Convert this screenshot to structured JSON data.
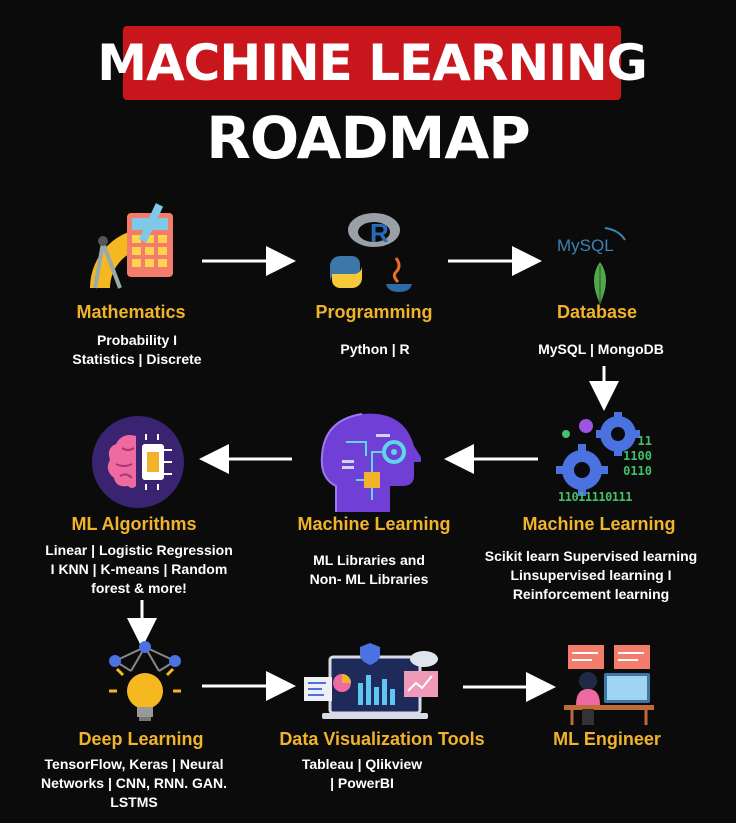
{
  "header": {
    "title": "MACHINE LEARNING",
    "subtitle": "ROADMAP"
  },
  "nodes": [
    {
      "title": "Mathematics",
      "desc": "Probability I\nStatistics | Discrete",
      "icon": "math-tools-icon"
    },
    {
      "title": "Programming",
      "desc": "Python | R",
      "icon": "programming-languages-icon"
    },
    {
      "title": "Database",
      "desc": "MySQL | MongoDB",
      "icon": "database-icon"
    },
    {
      "title": "ML Algorithms",
      "desc": "Linear | Logistic Regression\nI KNN | K-means | Random\nforest & more!",
      "icon": "brain-chip-icon"
    },
    {
      "title": "Machine Learning",
      "desc": "ML Libraries and\nNon- ML Libraries",
      "icon": "ai-head-icon"
    },
    {
      "title": "Machine Learning",
      "desc": "Scikit learn Supervised learning\nLinsupervised learning I\nReinforcement learning",
      "icon": "gears-binary-icon"
    },
    {
      "title": "Deep Learning",
      "desc": "TensorFlow, Keras | Neural\nNetworks | CNN, RNN. GAN.\nLSTMS",
      "icon": "neural-bulb-icon"
    },
    {
      "title": "Data Visualization Tools",
      "desc": "Tableau | Qlikview\n| PowerBI",
      "icon": "dashboard-icon"
    },
    {
      "title": "ML Engineer",
      "desc": "",
      "icon": "engineer-desk-icon"
    }
  ],
  "icon_texts": {
    "r_logo": "R",
    "mysql_logo": "MySQL",
    "binary": [
      "11",
      "1100",
      "0110",
      "11011110111"
    ]
  },
  "colors": {
    "title_bg": "#c8161c",
    "node_title": "#f0b32a",
    "background": "#0b0b0b"
  }
}
